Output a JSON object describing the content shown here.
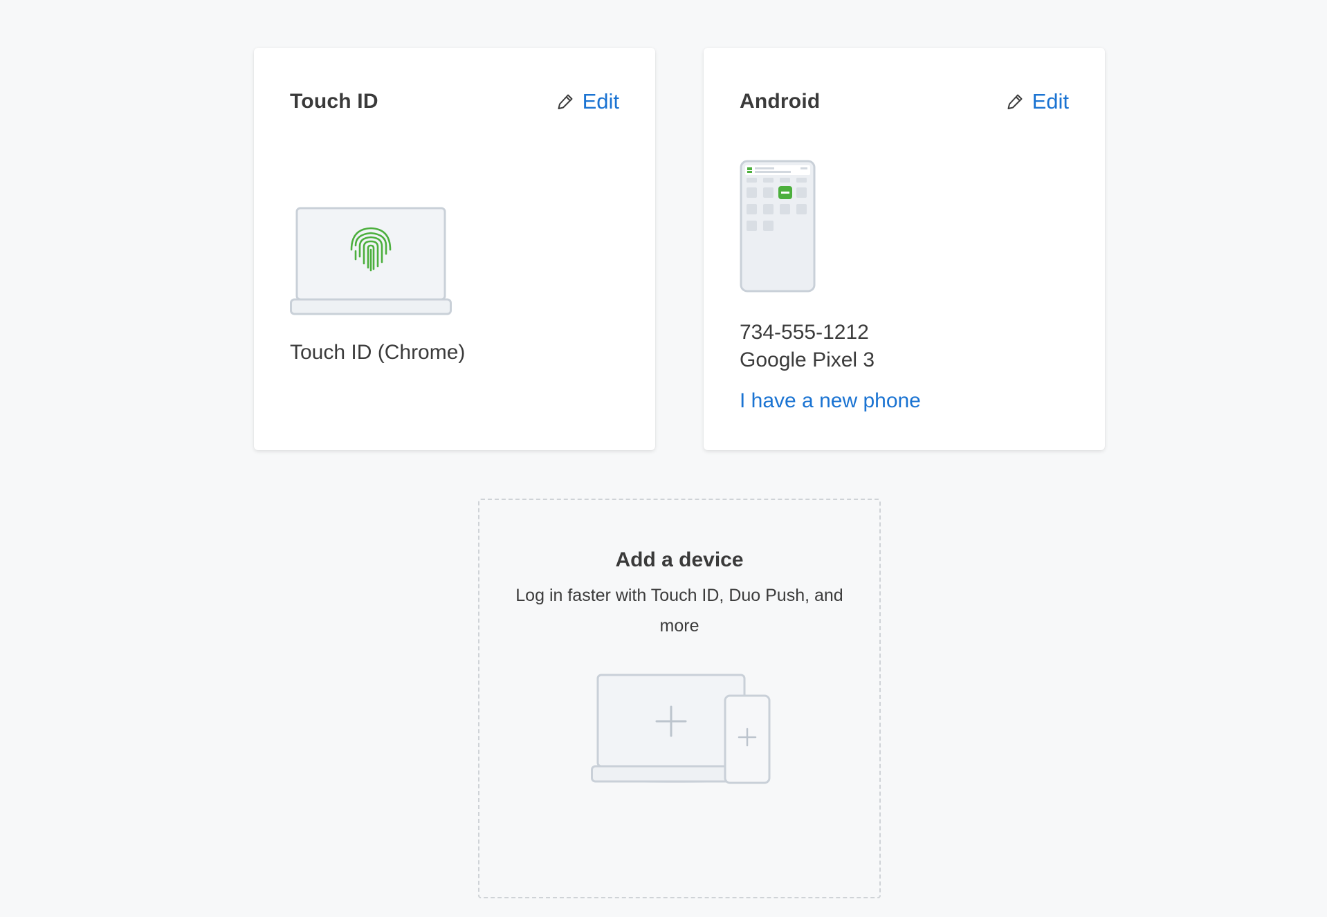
{
  "colors": {
    "page_background": "#f7f8f9",
    "link": "#1a73d2",
    "fingerprint": "#4caf3d",
    "illustration_stroke": "#c9d0d8",
    "illustration_fill": "#f2f4f7"
  },
  "devices": [
    {
      "title": "Touch ID",
      "edit_label": "Edit",
      "edit_icon": "pencil-icon",
      "illustration": "laptop-fingerprint",
      "name": "Touch ID (Chrome)"
    },
    {
      "title": "Android",
      "edit_label": "Edit",
      "edit_icon": "pencil-icon",
      "illustration": "phone-duo-app",
      "phone_number": "734-555-1212",
      "model": "Google Pixel 3",
      "new_phone_link": "I have a new phone"
    }
  ],
  "add_device": {
    "title": "Add a device",
    "description": "Log in faster with Touch ID, Duo Push, and more",
    "illustration": "laptop-phone-plus"
  }
}
